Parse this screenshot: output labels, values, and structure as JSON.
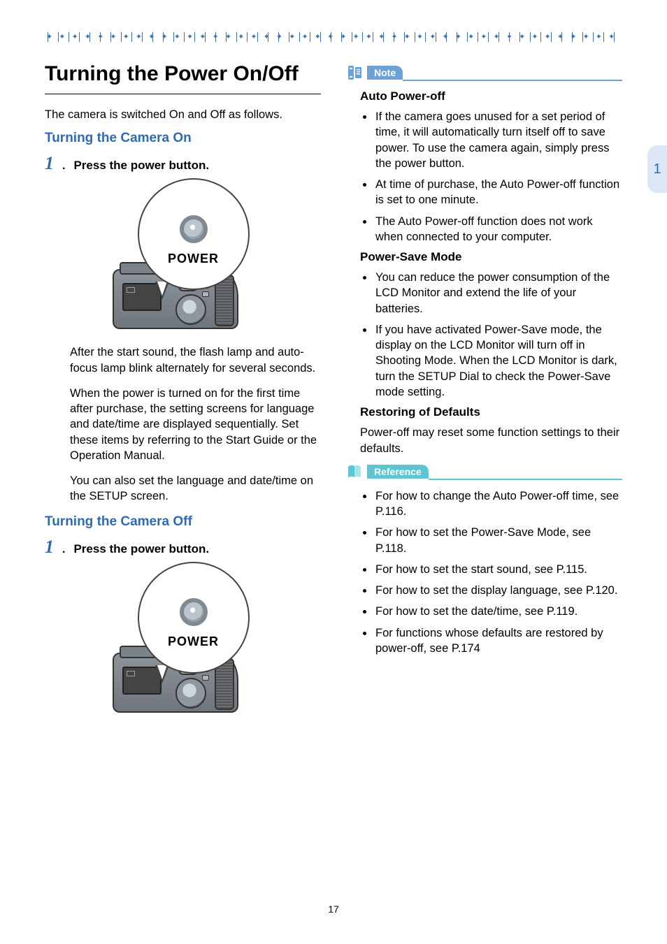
{
  "page_number": "17",
  "side_tab": "1",
  "left": {
    "main_title": "Turning the Power On/Off",
    "intro": "The camera is switched On and Off as follows.",
    "section_on": {
      "heading": "Turning the Camera On",
      "step1_num": "1",
      "step1_text": "Press the power button.",
      "power_label": "POWER",
      "para1": "After the start sound, the flash lamp and auto-focus lamp blink alternately for several seconds.",
      "para2": "When the power is turned on for the first time after purchase, the setting screens for language and date/time are displayed sequentially. Set these items by referring to the Start Guide or the Operation Manual.",
      "para3": "You can also set the language and date/time on the SETUP screen."
    },
    "section_off": {
      "heading": "Turning the Camera Off",
      "step1_num": "1",
      "step1_text": "Press the power button.",
      "power_label": "POWER"
    }
  },
  "right": {
    "note_label": "Note",
    "auto_poweroff_heading": "Auto Power-off",
    "auto_poweroff_bullets": [
      "If the camera goes unused for a set period of time, it will automatically turn itself off to save power. To use the camera again, simply press the power button.",
      "At time of purchase, the Auto Power-off function is set to one minute.",
      "The Auto Power-off function does not work when connected to your computer."
    ],
    "powersave_heading": "Power-Save Mode",
    "powersave_bullets": [
      "You can reduce the power consumption of the LCD Monitor and extend the life of your batteries.",
      "If you have activated Power-Save mode, the display on the LCD Monitor will turn off in Shooting Mode. When the LCD Monitor is dark, turn the SETUP Dial to check the Power-Save mode setting."
    ],
    "restoring_heading": "Restoring of Defaults",
    "restoring_text": "Power-off may reset some function settings to their defaults.",
    "reference_label": "Reference",
    "reference_bullets": [
      "For how to change the Auto Power-off time, see P.116.",
      "For how to set the Power-Save Mode, see P.118.",
      "For how to set the start sound, see P.115.",
      "For how to set the display language, see P.120.",
      "For how to set the date/time, see P.119.",
      "For functions whose defaults are restored by power-off, see P.174"
    ]
  }
}
